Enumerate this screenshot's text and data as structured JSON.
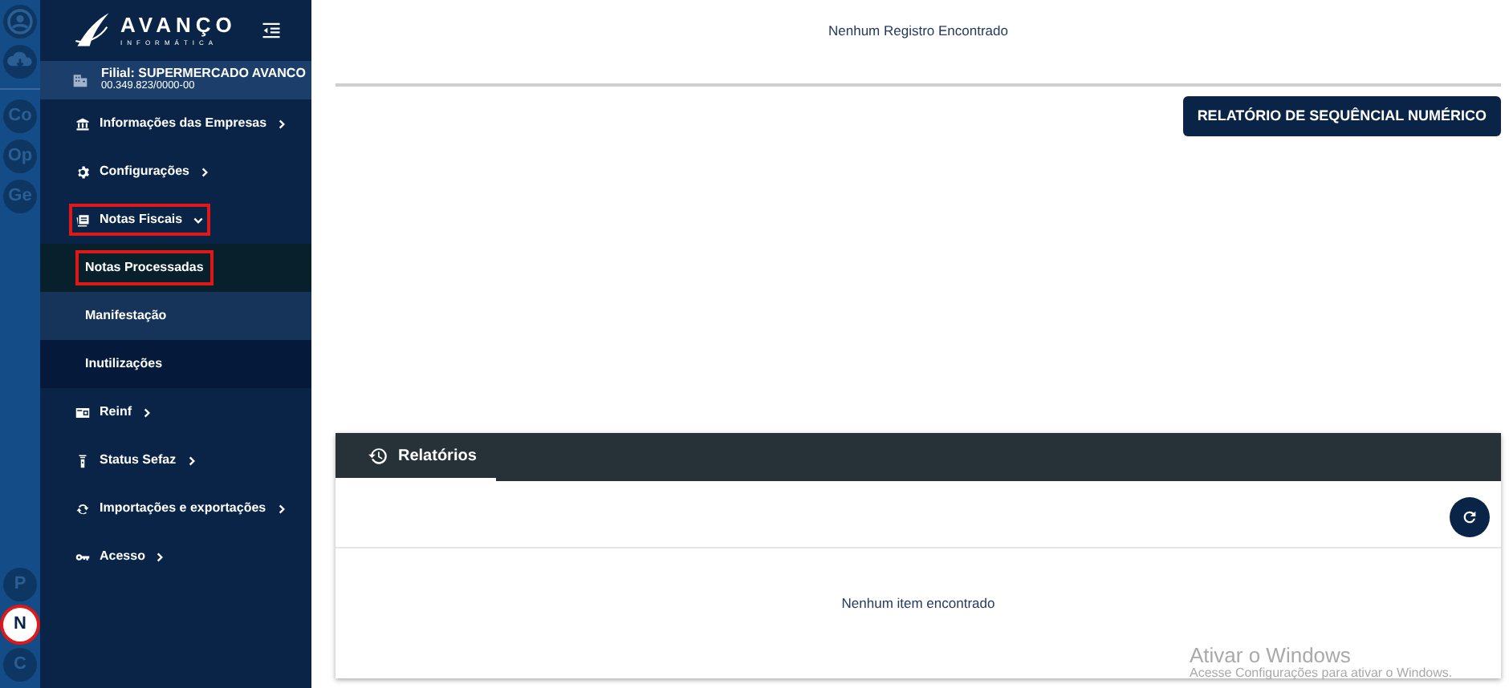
{
  "rail": {
    "top_icons": [
      {
        "kind": "user"
      },
      {
        "kind": "cloud"
      }
    ],
    "items": [
      {
        "label": "Co",
        "selected": false,
        "highlighted": false
      },
      {
        "label": "Op",
        "selected": false,
        "highlighted": false
      },
      {
        "label": "Ge",
        "selected": false,
        "highlighted": false
      }
    ],
    "bottom_items": [
      {
        "label": "P",
        "selected": false,
        "highlighted": false
      },
      {
        "label": "N",
        "selected": true,
        "highlighted": true
      },
      {
        "label": "C",
        "selected": false,
        "highlighted": false
      }
    ]
  },
  "logo": {
    "name": "AVANÇO",
    "subtitle": "INFORMÁTICA"
  },
  "branch": {
    "title": "Filial: SUPERMERCADO AVANCO",
    "document": "00.349.823/0000-00"
  },
  "menu": [
    {
      "label": "Informações das Empresas",
      "expanded": false,
      "highlighted": false
    },
    {
      "label": "Configurações",
      "expanded": false,
      "highlighted": false
    },
    {
      "label": "Notas Fiscais",
      "expanded": true,
      "highlighted": true,
      "children": [
        {
          "label": "Notas Processadas",
          "selected": true,
          "highlighted": true
        },
        {
          "label": "Manifestação",
          "selected": false,
          "highlighted": false
        },
        {
          "label": "Inutilizações",
          "selected": false,
          "highlighted": false
        }
      ]
    },
    {
      "label": "Reinf",
      "expanded": false,
      "highlighted": false
    },
    {
      "label": "Status Sefaz",
      "expanded": false,
      "highlighted": false
    },
    {
      "label": "Importações e exportações",
      "expanded": false,
      "highlighted": false
    },
    {
      "label": "Acesso",
      "expanded": false,
      "highlighted": false
    }
  ],
  "main": {
    "empty_message": "Nenhum Registro Encontrado",
    "report_button": "RELATÓRIO DE SEQUÊNCIAL NUMÉRICO",
    "reports_panel": {
      "tabs": [
        {
          "label": "Relatórios",
          "selected": true
        }
      ],
      "empty_message": "Nenhum item encontrado"
    }
  },
  "os_notice": {
    "title": "Ativar o Windows",
    "text": "Acesse Configurações para ativar o Windows."
  }
}
